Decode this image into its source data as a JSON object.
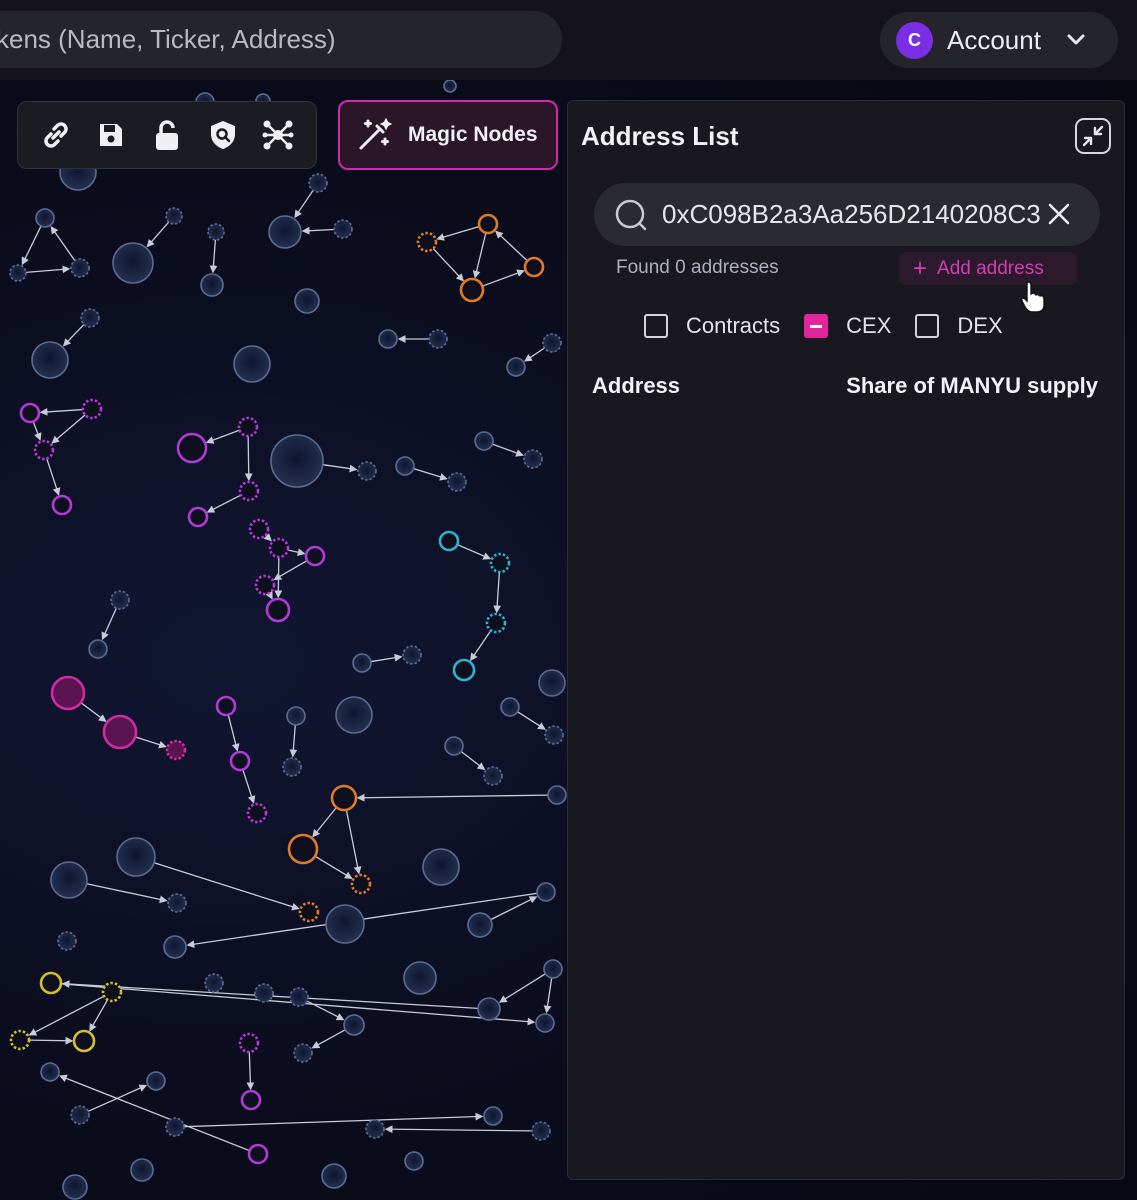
{
  "topbar": {
    "search_placeholder": "kens (Name, Ticker, Address)",
    "account_initial": "C",
    "account_label": "Account"
  },
  "toolbar": {
    "tools": [
      "link-icon",
      "save-icon",
      "lock-icon",
      "shield-search-icon",
      "network-icon"
    ],
    "magic_label": "Magic Nodes"
  },
  "panel": {
    "title": "Address List",
    "search_value": "0xC098B2a3Aa256D2140208C3",
    "found_text": "Found 0 addresses",
    "add_label": "Add address",
    "filters": [
      {
        "label": "Contracts",
        "checked": false
      },
      {
        "label": "CEX",
        "checked": true
      },
      {
        "label": "DEX",
        "checked": false
      }
    ],
    "columns": {
      "address": "Address",
      "share": "Share of MANYU supply"
    }
  },
  "colors": {
    "accent_magenta": "#d02bb0",
    "node_slate": "#5a6c94",
    "node_purple": "#b23ad6",
    "node_pink": "#cf2aa8",
    "node_orange": "#e07a28",
    "node_teal": "#2bb4cc",
    "node_yellow": "#d4c02c"
  }
}
